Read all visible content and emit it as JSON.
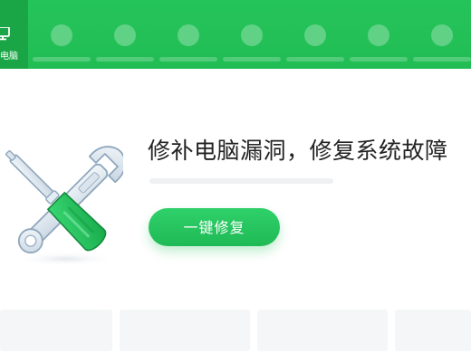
{
  "nav": {
    "active": {
      "label": "电脑",
      "icon": "monitor-icon"
    },
    "placeholder_count": 7
  },
  "hero": {
    "title": "修补电脑漏洞，修复系统故障",
    "progress_fraction": 0,
    "illustration": "wrench-screwdriver-icon",
    "button_label": "一键修复"
  },
  "colors": {
    "brand_green": "#22c55e",
    "nav_green": "#25c45a",
    "nav_active_bg": "#1aa646",
    "text_dark": "#222222"
  }
}
